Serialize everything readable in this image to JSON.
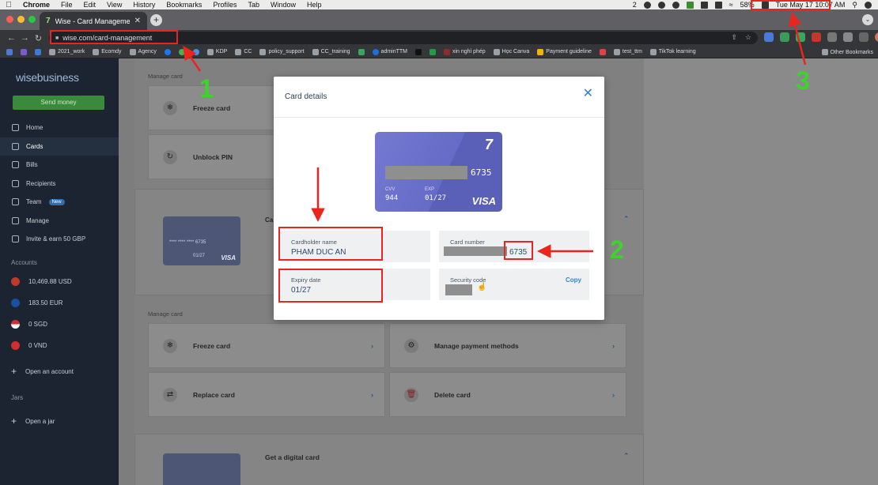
{
  "menubar": {
    "app": "Chrome",
    "items": [
      "File",
      "Edit",
      "View",
      "History",
      "Bookmarks",
      "Profiles",
      "Tab",
      "Window",
      "Help"
    ],
    "badge_count": "2",
    "battery": "58%",
    "clock": "Tue May 17  10:07 AM"
  },
  "browser": {
    "tab_title": "Wise - Card Management",
    "url": "wise.com/card-management",
    "bookmarks": [
      "2021_work",
      "Ecomdy",
      "Agency",
      "KDP",
      "CC",
      "policy_support",
      "CC_training",
      "adminTTM",
      "xin nghỉ phép",
      "Học Canva",
      "Payment guideline",
      "test_ttm",
      "TikTok learning"
    ],
    "other_bookmarks": "Other Bookmarks"
  },
  "sidebar": {
    "logo": "wisebusiness",
    "send_money": "Send money",
    "nav": [
      {
        "label": "Home",
        "icon": "home-icon"
      },
      {
        "label": "Cards",
        "icon": "card-icon"
      },
      {
        "label": "Bills",
        "icon": "bill-icon"
      },
      {
        "label": "Recipients",
        "icon": "recipients-icon"
      },
      {
        "label": "Team",
        "icon": "team-icon",
        "badge": "New"
      },
      {
        "label": "Manage",
        "icon": "manage-icon"
      },
      {
        "label": "Invite & earn 50 GBP",
        "icon": "gift-icon"
      }
    ],
    "accounts_heading": "Accounts",
    "accounts": [
      "10,469.88 USD",
      "183.50 EUR",
      "0 SGD",
      "0 VND"
    ],
    "open_account": "Open an account",
    "jars_heading": "Jars",
    "open_jar": "Open a jar"
  },
  "content": {
    "manage_card_label": "Manage card",
    "top_options": [
      "Freeze card",
      "Unblock PIN"
    ],
    "card_header_partial": "Ca",
    "minicard_number": "**** **** **** 6735",
    "minicard_expiry": "01/27",
    "minicard_brand": "VISA",
    "manage_card_label_2": "Manage card",
    "options": [
      "Freeze card",
      "Manage payment methods",
      "Replace card",
      "Delete card"
    ],
    "digital_card": "Get a digital card"
  },
  "modal": {
    "title": "Card details",
    "card": {
      "last4": "6735",
      "cvv_label": "CVV",
      "cvv": "944",
      "exp_label": "EXP",
      "exp": "01/27",
      "brand": "VISA"
    },
    "cardholder_label": "Cardholder name",
    "cardholder": "PHAM DUC AN",
    "card_number_label": "Card number",
    "card_number_last4": "6735",
    "expiry_label": "Expiry date",
    "expiry": "01/27",
    "security_label": "Security code",
    "copy": "Copy"
  },
  "annotations": {
    "one": "1",
    "two": "2",
    "three": "3"
  },
  "colors": {
    "sidebar_bg": "#1b2430",
    "accent_green": "#3a8a3b",
    "link_blue": "#2d88d8",
    "annotation_red": "#e8261f",
    "annotation_number_green": "#3fd12e"
  }
}
